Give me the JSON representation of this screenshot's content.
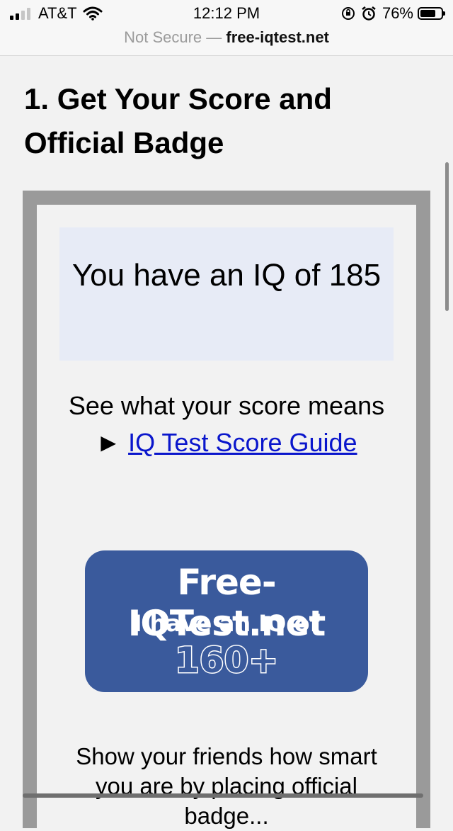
{
  "status_bar": {
    "carrier": "AT&T",
    "time": "12:12 PM",
    "battery": "76%",
    "battery_level": 0.76,
    "icons": [
      "signal-icon",
      "wifi-icon",
      "orientation-lock-icon",
      "alarm-icon",
      "battery-icon"
    ]
  },
  "browser": {
    "security_label": "Not Secure —",
    "domain": "free-iqtest.net"
  },
  "main": {
    "heading": "1. Get Your Score and Official Badge",
    "score_text": "You have an IQ of 185",
    "guide_prefix": "See what your score means ► ",
    "guide_link": "IQ Test Score Guide",
    "badge": {
      "site": "Free-IQTest.net",
      "line": "I have an IQ of",
      "score": "160+"
    },
    "share_text": "Show your friends how smart you are by placing official badge..."
  },
  "colors": {
    "badge_bg": "#3a5a9c",
    "score_box_bg": "#e7ebf6",
    "link": "#0a16cc",
    "frame": "#9a9a9a"
  }
}
